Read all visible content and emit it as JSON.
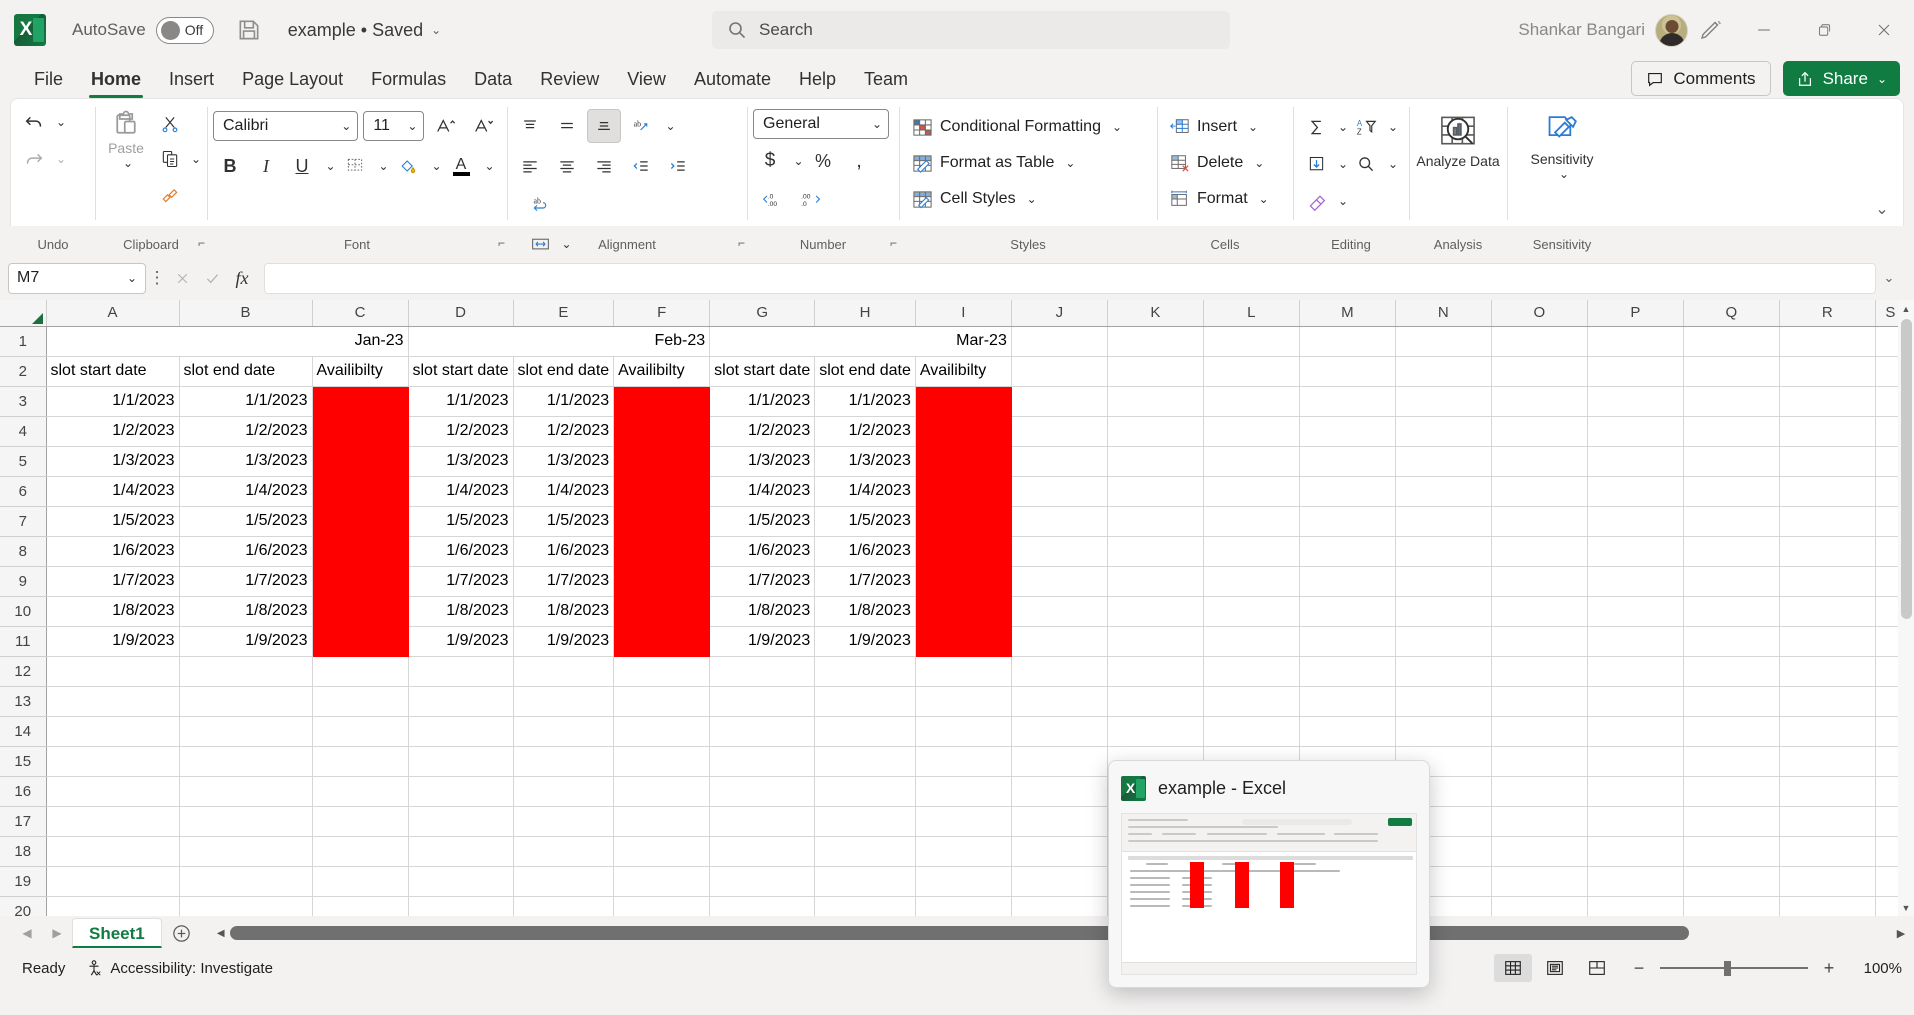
{
  "titlebar": {
    "autosave_label": "AutoSave",
    "autosave_state": "Off",
    "document_title": "example • Saved",
    "user_name": "Shankar Bangari",
    "save_icon": "save-icon",
    "pen_icon": "pen-icon",
    "minimize": "—",
    "restore": "❐",
    "close": "✕"
  },
  "search": {
    "placeholder": "Search",
    "value": ""
  },
  "tabs": [
    {
      "label": "File",
      "active": false
    },
    {
      "label": "Home",
      "active": true
    },
    {
      "label": "Insert",
      "active": false
    },
    {
      "label": "Page Layout",
      "active": false
    },
    {
      "label": "Formulas",
      "active": false
    },
    {
      "label": "Data",
      "active": false
    },
    {
      "label": "Review",
      "active": false
    },
    {
      "label": "View",
      "active": false
    },
    {
      "label": "Automate",
      "active": false
    },
    {
      "label": "Help",
      "active": false
    },
    {
      "label": "Team",
      "active": false
    }
  ],
  "header_actions": {
    "comments": "Comments",
    "share": "Share"
  },
  "ribbon": {
    "groups": [
      {
        "label": "Undo"
      },
      {
        "label": "Clipboard"
      },
      {
        "label": "Font"
      },
      {
        "label": "Alignment"
      },
      {
        "label": "Number"
      },
      {
        "label": "Styles"
      },
      {
        "label": "Cells"
      },
      {
        "label": "Editing"
      },
      {
        "label": "Analysis"
      },
      {
        "label": "Sensitivity"
      }
    ],
    "clipboard": {
      "paste": "Paste"
    },
    "font": {
      "family": "Calibri",
      "size": "11",
      "bold": "B",
      "italic": "I",
      "underline": "U"
    },
    "number": {
      "format": "General",
      "currency": "$",
      "percent": "%",
      "comma": ","
    },
    "styles": {
      "conditional_formatting": "Conditional Formatting",
      "format_as_table": "Format as Table",
      "cell_styles": "Cell Styles"
    },
    "cells": {
      "insert": "Insert",
      "delete": "Delete",
      "format": "Format"
    },
    "analysis": {
      "analyze_data": "Analyze Data"
    },
    "sensitivity": {
      "label": "Sensitivity"
    }
  },
  "formula_bar": {
    "name_box": "M7",
    "formula": "",
    "cancel": "✕",
    "enter": "✓",
    "fx": "fx"
  },
  "grid": {
    "columns": [
      "A",
      "B",
      "C",
      "D",
      "E",
      "F",
      "G",
      "H",
      "I",
      "J",
      "K",
      "L",
      "M",
      "N",
      "O",
      "P",
      "Q",
      "R",
      "S"
    ],
    "rows": [
      1,
      2,
      3,
      4,
      5,
      6,
      7,
      8,
      9,
      10,
      11,
      12,
      13,
      14,
      15,
      16,
      17,
      18,
      19,
      20
    ],
    "months": [
      "Jan-23",
      "Feb-23",
      "Mar-23"
    ],
    "headers": [
      "slot start date",
      "slot end date",
      "Availibilty",
      "slot start date",
      "slot end date",
      "Availibilty",
      "slot start date",
      "slot end date",
      "Availibilty"
    ],
    "data_rows": [
      [
        "1/1/2023",
        "1/1/2023",
        "",
        "1/1/2023",
        "1/1/2023",
        "",
        "1/1/2023",
        "1/1/2023",
        ""
      ],
      [
        "1/2/2023",
        "1/2/2023",
        "",
        "1/2/2023",
        "1/2/2023",
        "",
        "1/2/2023",
        "1/2/2023",
        ""
      ],
      [
        "1/3/2023",
        "1/3/2023",
        "",
        "1/3/2023",
        "1/3/2023",
        "",
        "1/3/2023",
        "1/3/2023",
        ""
      ],
      [
        "1/4/2023",
        "1/4/2023",
        "",
        "1/4/2023",
        "1/4/2023",
        "",
        "1/4/2023",
        "1/4/2023",
        ""
      ],
      [
        "1/5/2023",
        "1/5/2023",
        "",
        "1/5/2023",
        "1/5/2023",
        "",
        "1/5/2023",
        "1/5/2023",
        ""
      ],
      [
        "1/6/2023",
        "1/6/2023",
        "",
        "1/6/2023",
        "1/6/2023",
        "",
        "1/6/2023",
        "1/6/2023",
        ""
      ],
      [
        "1/7/2023",
        "1/7/2023",
        "",
        "1/7/2023",
        "1/7/2023",
        "",
        "1/7/2023",
        "1/7/2023",
        ""
      ],
      [
        "1/8/2023",
        "1/8/2023",
        "",
        "1/8/2023",
        "1/8/2023",
        "",
        "1/8/2023",
        "1/8/2023",
        ""
      ],
      [
        "1/9/2023",
        "1/9/2023",
        "",
        "1/9/2023",
        "1/9/2023",
        "",
        "1/9/2023",
        "1/9/2023",
        ""
      ]
    ],
    "availability_fill_color": "#ff0000",
    "selected_cell": "M7"
  },
  "sheet_tabs": {
    "active": "Sheet1",
    "add": "+"
  },
  "status": {
    "ready": "Ready",
    "accessibility": "Accessibility: Investigate",
    "zoom": "100%",
    "view_normal": "normal-view",
    "view_pagelayout": "page-layout-view",
    "view_pagebreak": "page-break-view"
  },
  "preview_popup": {
    "title": "example - Excel"
  }
}
